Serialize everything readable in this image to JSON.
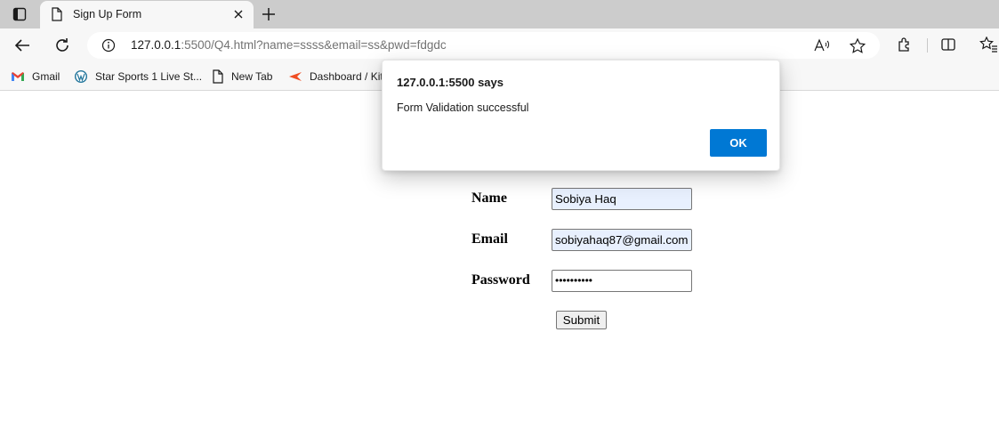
{
  "browser": {
    "tab": {
      "title": "Sign Up Form"
    },
    "address_bar": {
      "url_host": "127.0.0.1",
      "url_rest": ":5500/Q4.html?name=ssss&email=ss&pwd=fdgdc"
    },
    "bookmarks": [
      {
        "label": "Gmail",
        "icon": "gmail-icon"
      },
      {
        "label": "Star Sports 1 Live St...",
        "icon": "wordpress-icon"
      },
      {
        "label": "New Tab",
        "icon": "page-icon"
      },
      {
        "label": "Dashboard / Kit",
        "icon": "kit-icon"
      }
    ]
  },
  "form": {
    "name_label": "Name",
    "name_value": "Sobiya Haq",
    "email_label": "Email",
    "email_value": "sobiyahaq87@gmail.com",
    "password_label": "Password",
    "password_value": "••••••••••",
    "submit_label": "Submit"
  },
  "dialog": {
    "title": "127.0.0.1:5500 says",
    "message": "Form Validation successful",
    "ok_label": "OK"
  },
  "colors": {
    "accent": "#0078d4",
    "autofill_bg": "#e8f0fe",
    "tabstrip_bg": "#cccccc"
  }
}
